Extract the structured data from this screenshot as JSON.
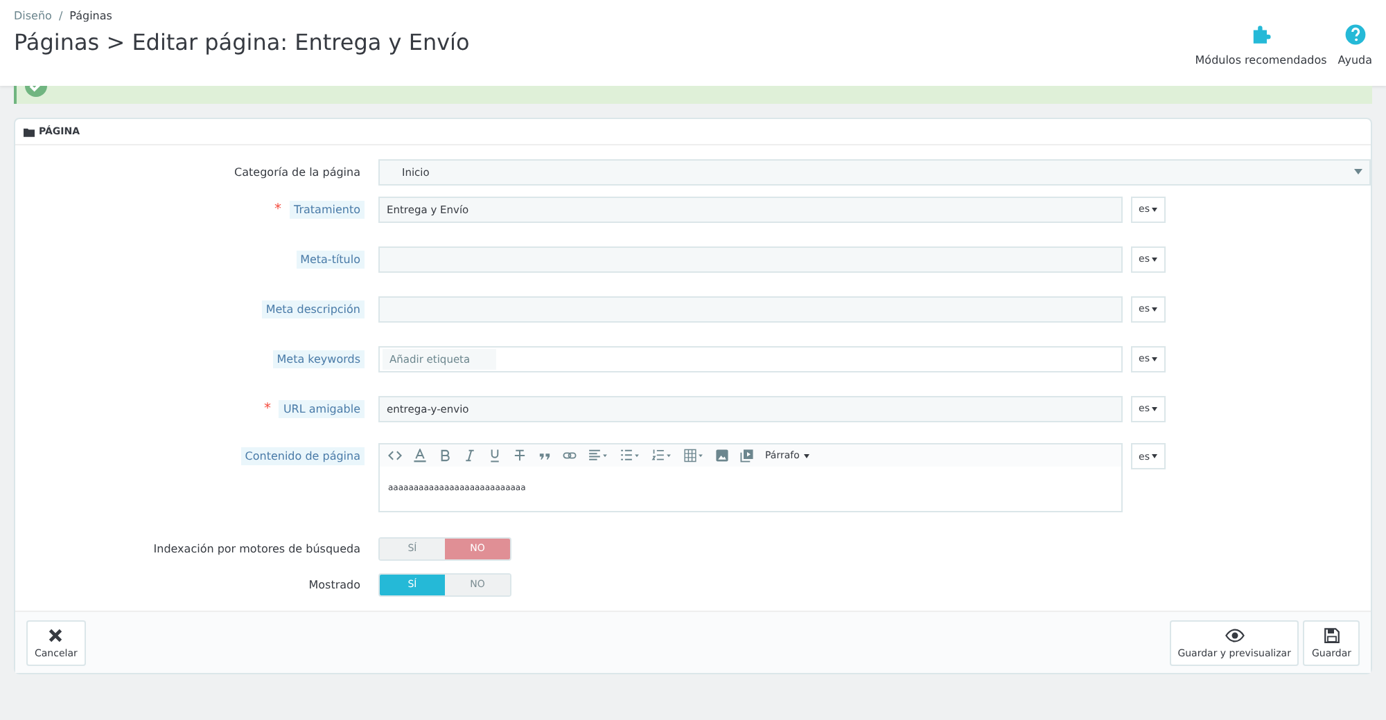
{
  "breadcrumb": [
    {
      "label": "Diseño"
    },
    {
      "label": "Páginas"
    }
  ],
  "breadcrumb_separator": "/",
  "required_mark": "*",
  "page_title": "Páginas > Editar página: Entrega y Envío",
  "toolbar": [
    {
      "kind": "modules",
      "label": "Módulos recomendados"
    },
    {
      "kind": "help",
      "label": "Ayuda"
    }
  ],
  "panel": {
    "title": "PÁGINA"
  },
  "fields": [
    {
      "kind": "select",
      "label": "Categoría de la página",
      "required": false,
      "value": "Inicio"
    },
    {
      "kind": "text",
      "label": "Tratamiento",
      "required": true,
      "value": "Entrega y Envío",
      "lang": "es"
    },
    {
      "kind": "text",
      "label": "Meta-título",
      "required": false,
      "lang": "es"
    },
    {
      "kind": "text",
      "label": "Meta descripción",
      "required": false,
      "lang": "es"
    },
    {
      "kind": "tags",
      "label": "Meta keywords",
      "required": false,
      "placeholder": "Añadir etiqueta",
      "lang": "es"
    },
    {
      "kind": "text",
      "label": "URL amigable",
      "required": true,
      "value": "entrega-y-envio",
      "lang": "es"
    },
    {
      "kind": "editor",
      "label": "Contenido de página",
      "required": false,
      "format": "Párrafo",
      "value": "aaaaaaaaaaaaaaaaaaaaaaaaaaa",
      "lang": "es"
    }
  ],
  "switches": [
    {
      "label": "Indexación por motores de búsqueda",
      "options": [
        {
          "label": "SÍ",
          "selected": false
        },
        {
          "label": "NO",
          "selected": true
        }
      ]
    },
    {
      "label": "Mostrado",
      "options": [
        {
          "label": "SÍ",
          "selected": true
        },
        {
          "label": "NO",
          "selected": false
        }
      ]
    }
  ],
  "footer_buttons": [
    {
      "kind": "cancel",
      "label": "Cancelar"
    },
    {
      "kind": "preview",
      "label": "Guardar y previsualizar"
    },
    {
      "kind": "save",
      "label": "Guardar"
    }
  ]
}
